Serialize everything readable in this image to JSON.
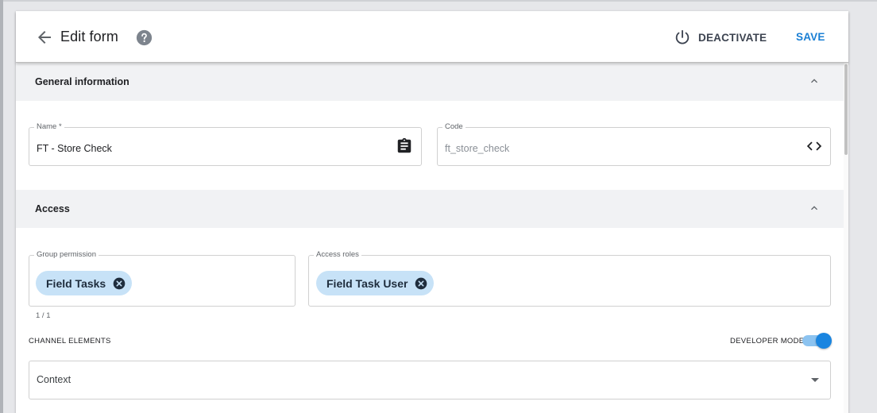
{
  "header": {
    "title": "Edit form",
    "deactivate_label": "DEACTIVATE",
    "save_label": "SAVE"
  },
  "general": {
    "section_title": "General information",
    "name": {
      "label": "Name *",
      "value": "FT - Store Check"
    },
    "code": {
      "label": "Code",
      "value": "ft_store_check"
    }
  },
  "access": {
    "section_title": "Access",
    "group_permission": {
      "label": "Group permission",
      "chips": [
        "Field Tasks"
      ],
      "counter": "1 / 1"
    },
    "access_roles": {
      "label": "Access roles",
      "chips": [
        "Field Task User"
      ]
    },
    "channel_elements_label": "CHANNEL ELEMENTS",
    "developer_mode_label": "DEVELOPER MODE",
    "developer_mode_on": true,
    "context_select": {
      "value": "Context"
    }
  },
  "colors": {
    "accent": "#1a7fd4",
    "chip_bg": "#c7e2f7",
    "section_bg": "#f1f2f4"
  },
  "icons": {
    "back": "arrow-left-icon",
    "help": "help-circle-icon",
    "deactivate": "power-icon",
    "name_field": "clipboard-icon",
    "code_field": "code-brackets-icon",
    "chip_remove": "close-circle-icon",
    "collapse": "chevron-up-icon",
    "select": "caret-down-icon"
  }
}
